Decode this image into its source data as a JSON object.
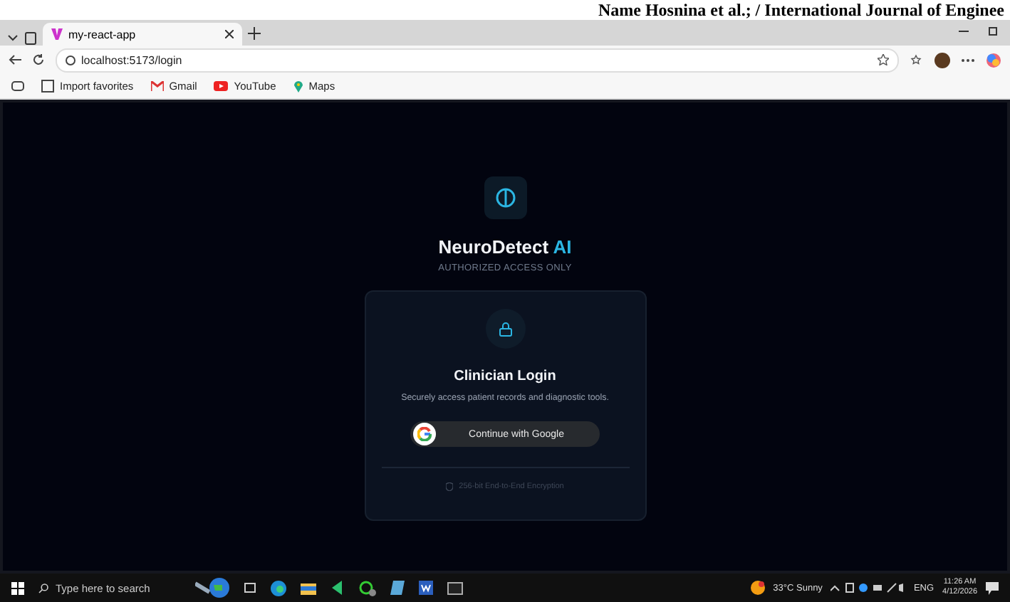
{
  "document_header": "Name Hosnina et al.; / International Journal of Enginee",
  "browser": {
    "tab": {
      "title": "my-react-app",
      "selected": true
    },
    "address": "localhost:5173/login",
    "bookmarks": [
      {
        "label": "Import favorites",
        "kind": "favorites"
      },
      {
        "label": "Gmail",
        "kind": "gmail"
      },
      {
        "label": "YouTube",
        "kind": "youtube"
      },
      {
        "label": "Maps",
        "kind": "maps"
      }
    ]
  },
  "login": {
    "brand": "NeuroDetect",
    "brand_accent": "AI",
    "subtitle": "AUTHORIZED ACCESS ONLY",
    "card_title": "Clinician Login",
    "description": "Securely access patient records and diagnostic tools.",
    "button": "Continue with Google",
    "footer": "256-bit End-to-End Encryption"
  },
  "taskbar": {
    "search_placeholder": "Type here to search",
    "weather": "33°C  Sunny",
    "language": "ENG",
    "time": "11:26 AM",
    "date": "4/12/2026"
  }
}
